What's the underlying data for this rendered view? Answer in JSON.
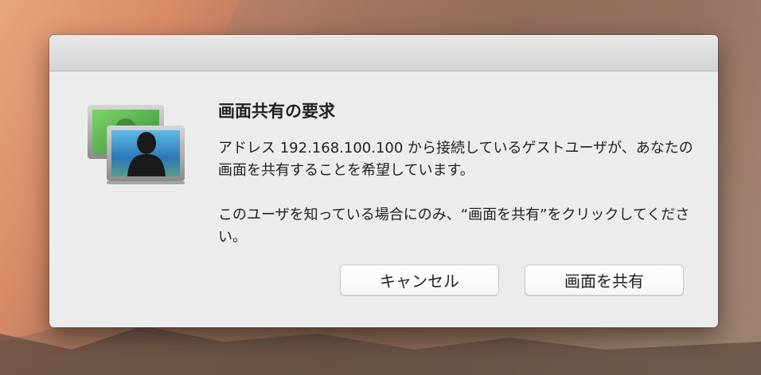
{
  "dialog": {
    "title": "画面共有の要求",
    "message_line1": "アドレス 192.168.100.100 から接続しているゲストユーザが、あなたの画面を共有することを希望しています。",
    "message_line2": "このユーザを知っている場合にのみ、“画面を共有”をクリックしてください。",
    "icon": "screen-sharing-app-icon"
  },
  "buttons": {
    "cancel_label": "キャンセル",
    "share_label": "画面を共有"
  }
}
